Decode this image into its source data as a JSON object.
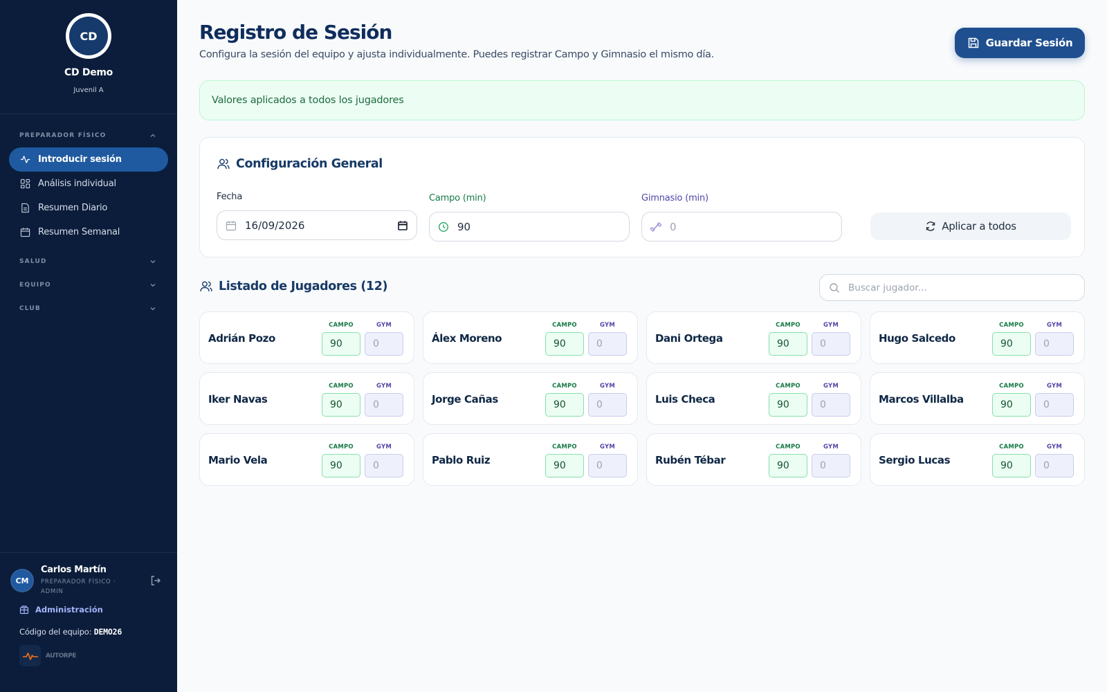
{
  "sidebar": {
    "logo_initials": "CD",
    "club_name": "CD Demo",
    "team_name": "Juvenil A",
    "sections": [
      {
        "label": "PREPARADOR FÍSICO"
      },
      {
        "label": "SALUD"
      },
      {
        "label": "EQUIPO"
      },
      {
        "label": "CLUB"
      }
    ],
    "nav_items": [
      {
        "label": "Introducir sesión",
        "icon": "activity-icon",
        "active": true
      },
      {
        "label": "Análisis individual",
        "icon": "grid-icon"
      },
      {
        "label": "Resumen Diario",
        "icon": "file-icon"
      },
      {
        "label": "Resumen Semanal",
        "icon": "calendar-icon"
      }
    ],
    "user": {
      "initials": "CM",
      "name": "Carlos Martín",
      "role": "PREPARADOR FÍSICO · ADMIN"
    },
    "admin_label": "Administración",
    "team_code_label": "Código del equipo:",
    "team_code": "DEMO26",
    "product_name": "AUTORPE"
  },
  "header": {
    "title": "Registro de Sesión",
    "subtitle": "Configura la sesión del equipo y ajusta individualmente. Puedes registrar Campo y Gimnasio el mismo día.",
    "save_label": "Guardar Sesión"
  },
  "banner": {
    "text": "Valores aplicados a todos los jugadores"
  },
  "config": {
    "title": "Configuración General",
    "date_label": "Fecha",
    "date_value": "16/09/2026",
    "campo_label": "Campo (min)",
    "campo_value": "90",
    "gym_label": "Gimnasio (min)",
    "gym_placeholder": "0",
    "apply_label": "Aplicar a todos"
  },
  "players_section": {
    "title": "Listado de Jugadores (12)",
    "search_placeholder": "Buscar jugador...",
    "campo_label": "CAMPO",
    "gym_label": "GYM"
  },
  "players": [
    {
      "name": "Adrián Pozo",
      "campo": "90",
      "gym": "0"
    },
    {
      "name": "Álex Moreno",
      "campo": "90",
      "gym": "0"
    },
    {
      "name": "Dani Ortega",
      "campo": "90",
      "gym": "0"
    },
    {
      "name": "Hugo Salcedo",
      "campo": "90",
      "gym": "0"
    },
    {
      "name": "Iker Navas",
      "campo": "90",
      "gym": "0"
    },
    {
      "name": "Jorge Cañas",
      "campo": "90",
      "gym": "0"
    },
    {
      "name": "Luis Checa",
      "campo": "90",
      "gym": "0"
    },
    {
      "name": "Marcos Villalba",
      "campo": "90",
      "gym": "0"
    },
    {
      "name": "Mario Vela",
      "campo": "90",
      "gym": "0"
    },
    {
      "name": "Pablo Ruiz",
      "campo": "90",
      "gym": "0"
    },
    {
      "name": "Rubén Tébar",
      "campo": "90",
      "gym": "0"
    },
    {
      "name": "Sergio Lucas",
      "campo": "90",
      "gym": "0"
    }
  ],
  "colors": {
    "sidebar_bg": "#0b1d3a",
    "accent": "#1f4f8f",
    "active_nav": "#1f5aa1",
    "success_bg": "#ecfdf3",
    "campo_green": "#157a46",
    "gym_indigo": "#4f46a8"
  }
}
